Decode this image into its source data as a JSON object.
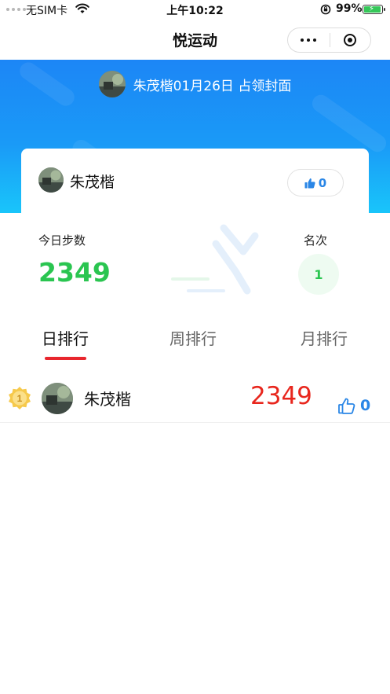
{
  "status_bar": {
    "carrier": "无SIM卡",
    "time": "上午10:22",
    "battery": "99%",
    "battery_level": 0.99
  },
  "nav": {
    "title": "悦运动"
  },
  "hero": {
    "cover_text": "朱茂楷01月26日 占领封面"
  },
  "card": {
    "user_name": "朱茂楷",
    "like_count": "0"
  },
  "stats": {
    "steps_label": "今日步数",
    "steps_value": "2349",
    "rank_label": "名次",
    "rank_value": "1"
  },
  "tabs": [
    {
      "label": "日排行",
      "active": true
    },
    {
      "label": "周排行",
      "active": false
    },
    {
      "label": "月排行",
      "active": false
    }
  ],
  "ranking": [
    {
      "rank_badge": "1",
      "name": "朱茂楷",
      "steps": "2349",
      "likes": "0"
    }
  ],
  "colors": {
    "brand_blue": "#1c86f6",
    "steps_green": "#2ac550",
    "steps_red": "#e8261d",
    "like_blue": "#2a86e6",
    "tab_indicator": "#e8262e"
  },
  "icons": {
    "wifi": "wifi-icon",
    "orientation_lock": "orientation-lock-icon",
    "more": "more-dots-icon",
    "close_miniprogram": "close-target-icon",
    "thumbs_up": "thumbs-up-icon",
    "medal": "gold-medal-icon"
  }
}
